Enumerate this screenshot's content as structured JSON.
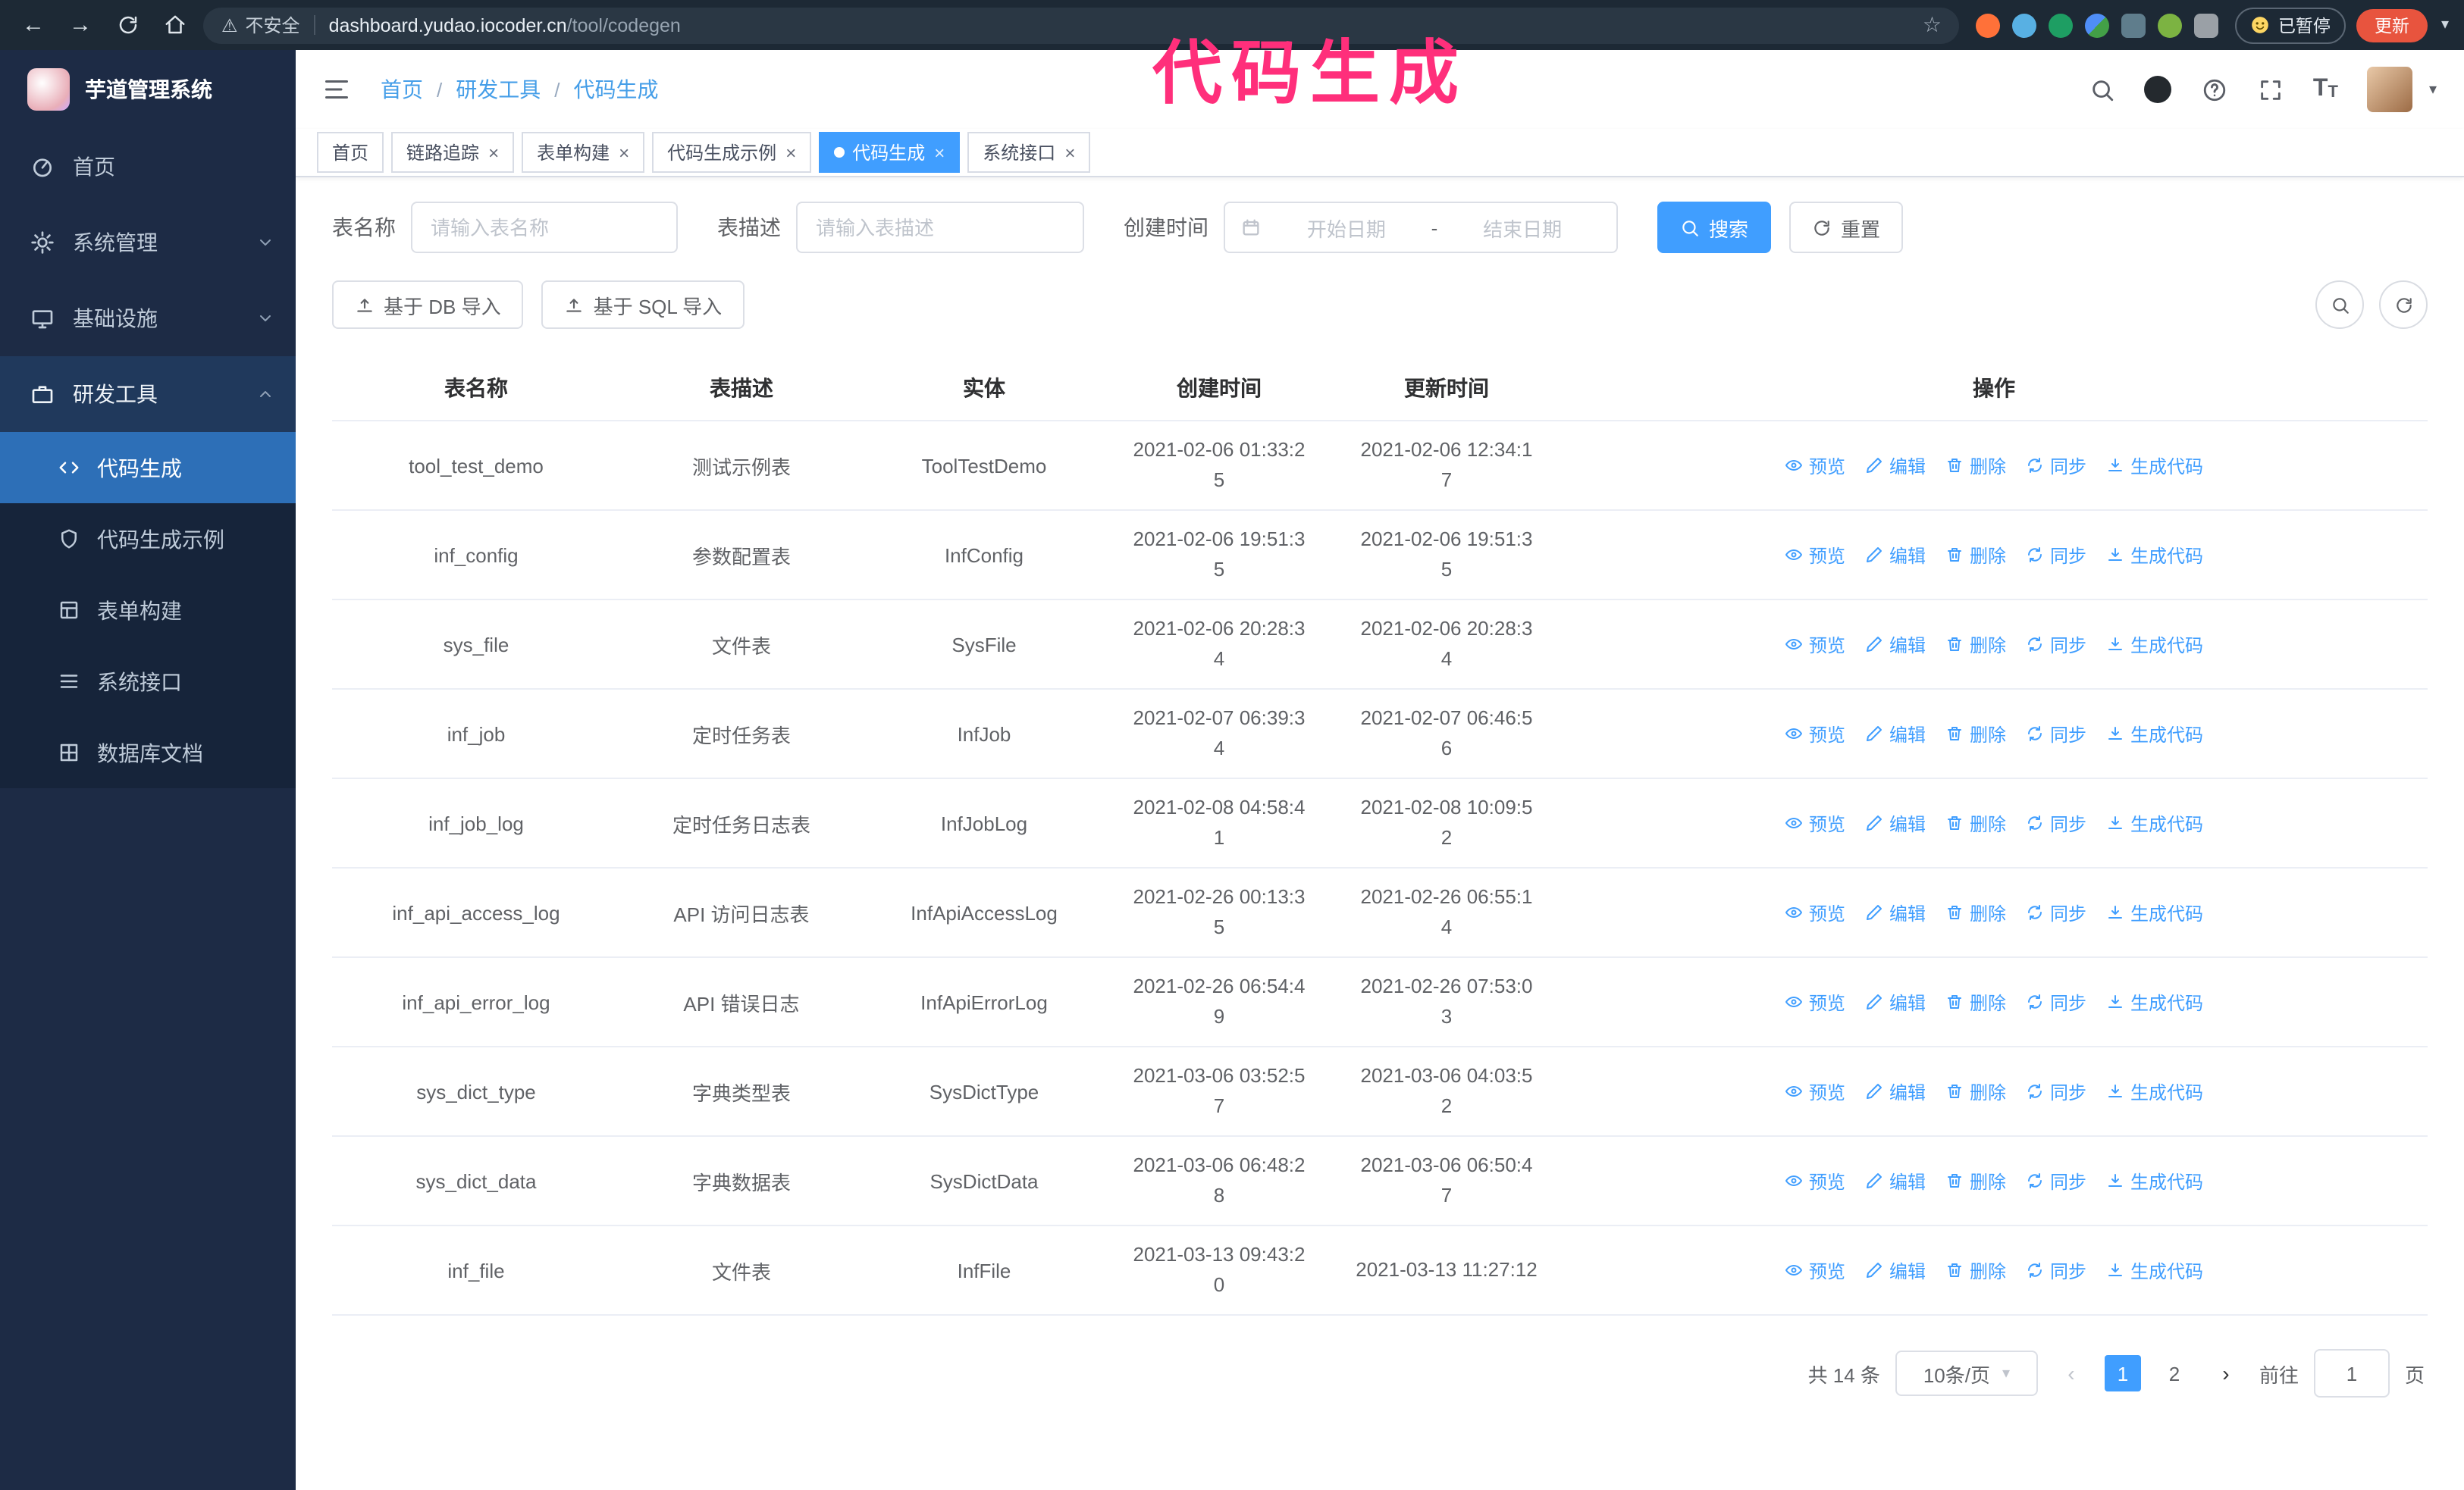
{
  "browser": {
    "security_label": "不安全",
    "url_host": "dashboard.yudao.iocoder.cn",
    "url_path": "/tool/codegen",
    "paused_badge": "已暂停",
    "update_button": "更新"
  },
  "annotation": {
    "text": "代码生成",
    "color": "#ff2f7b"
  },
  "sidebar": {
    "logo_title": "芋道管理系统",
    "items": [
      {
        "label": "首页"
      },
      {
        "label": "系统管理"
      },
      {
        "label": "基础设施"
      },
      {
        "label": "研发工具"
      }
    ],
    "sub_items": [
      {
        "label": "代码生成",
        "active": true
      },
      {
        "label": "代码生成示例"
      },
      {
        "label": "表单构建"
      },
      {
        "label": "系统接口"
      },
      {
        "label": "数据库文档"
      }
    ]
  },
  "header": {
    "breadcrumb": [
      "首页",
      "研发工具",
      "代码生成"
    ]
  },
  "tabs": [
    {
      "label": "首页",
      "closable": false,
      "active": false
    },
    {
      "label": "链路追踪",
      "closable": true,
      "active": false
    },
    {
      "label": "表单构建",
      "closable": true,
      "active": false
    },
    {
      "label": "代码生成示例",
      "closable": true,
      "active": false
    },
    {
      "label": "代码生成",
      "closable": true,
      "active": true
    },
    {
      "label": "系统接口",
      "closable": true,
      "active": false
    }
  ],
  "filters": {
    "name_label": "表名称",
    "name_placeholder": "请输入表名称",
    "desc_label": "表描述",
    "desc_placeholder": "请输入表描述",
    "time_label": "创建时间",
    "start_placeholder": "开始日期",
    "range_separator": "-",
    "end_placeholder": "结束日期",
    "search_button": "搜索",
    "reset_button": "重置"
  },
  "toolbar": {
    "import_db_button": "基于 DB 导入",
    "import_sql_button": "基于 SQL 导入"
  },
  "table": {
    "columns": [
      "表名称",
      "表描述",
      "实体",
      "创建时间",
      "更新时间",
      "操作"
    ],
    "actions": [
      "预览",
      "编辑",
      "删除",
      "同步",
      "生成代码"
    ],
    "rows": [
      {
        "name": "tool_test_demo",
        "desc": "测试示例表",
        "entity": "ToolTestDemo",
        "created": "2021-02-06 01:33:25",
        "updated": "2021-02-06 12:34:17"
      },
      {
        "name": "inf_config",
        "desc": "参数配置表",
        "entity": "InfConfig",
        "created": "2021-02-06 19:51:35",
        "updated": "2021-02-06 19:51:35"
      },
      {
        "name": "sys_file",
        "desc": "文件表",
        "entity": "SysFile",
        "created": "2021-02-06 20:28:34",
        "updated": "2021-02-06 20:28:34"
      },
      {
        "name": "inf_job",
        "desc": "定时任务表",
        "entity": "InfJob",
        "created": "2021-02-07 06:39:34",
        "updated": "2021-02-07 06:46:56"
      },
      {
        "name": "inf_job_log",
        "desc": "定时任务日志表",
        "entity": "InfJobLog",
        "created": "2021-02-08 04:58:41",
        "updated": "2021-02-08 10:09:52"
      },
      {
        "name": "inf_api_access_log",
        "desc": "API 访问日志表",
        "entity": "InfApiAccessLog",
        "created": "2021-02-26 00:13:35",
        "updated": "2021-02-26 06:55:14"
      },
      {
        "name": "inf_api_error_log",
        "desc": "API 错误日志",
        "entity": "InfApiErrorLog",
        "created": "2021-02-26 06:54:49",
        "updated": "2021-02-26 07:53:03"
      },
      {
        "name": "sys_dict_type",
        "desc": "字典类型表",
        "entity": "SysDictType",
        "created": "2021-03-06 03:52:57",
        "updated": "2021-03-06 04:03:52"
      },
      {
        "name": "sys_dict_data",
        "desc": "字典数据表",
        "entity": "SysDictData",
        "created": "2021-03-06 06:48:28",
        "updated": "2021-03-06 06:50:47"
      },
      {
        "name": "inf_file",
        "desc": "文件表",
        "entity": "InfFile",
        "created": "2021-03-13 09:43:20",
        "updated": "2021-03-13 11:27:12"
      }
    ]
  },
  "pagination": {
    "total_label": "共 14 条",
    "page_size": "10条/页",
    "pages": [
      "1",
      "2"
    ],
    "active_page": "1",
    "goto_prefix": "前往",
    "goto_value": "1",
    "goto_suffix": "页"
  },
  "icons": {
    "close": "×",
    "star": "☆",
    "warning": "⚠",
    "caret_down": "▾",
    "back_arrow": "←",
    "forward_arrow": "→",
    "prev_arrow": "‹",
    "next_arrow": "›",
    "breadcrumb_separator": "/",
    "font_size_letter": "T"
  },
  "colors": {
    "accent": "#409eff",
    "annotation_pink": "#ff2f7b",
    "update_button": "#e8543e",
    "sidebar_bg": "#1d2b45",
    "submenu_bg": "#16243a",
    "active_menu_bg": "#2d6fb7"
  }
}
